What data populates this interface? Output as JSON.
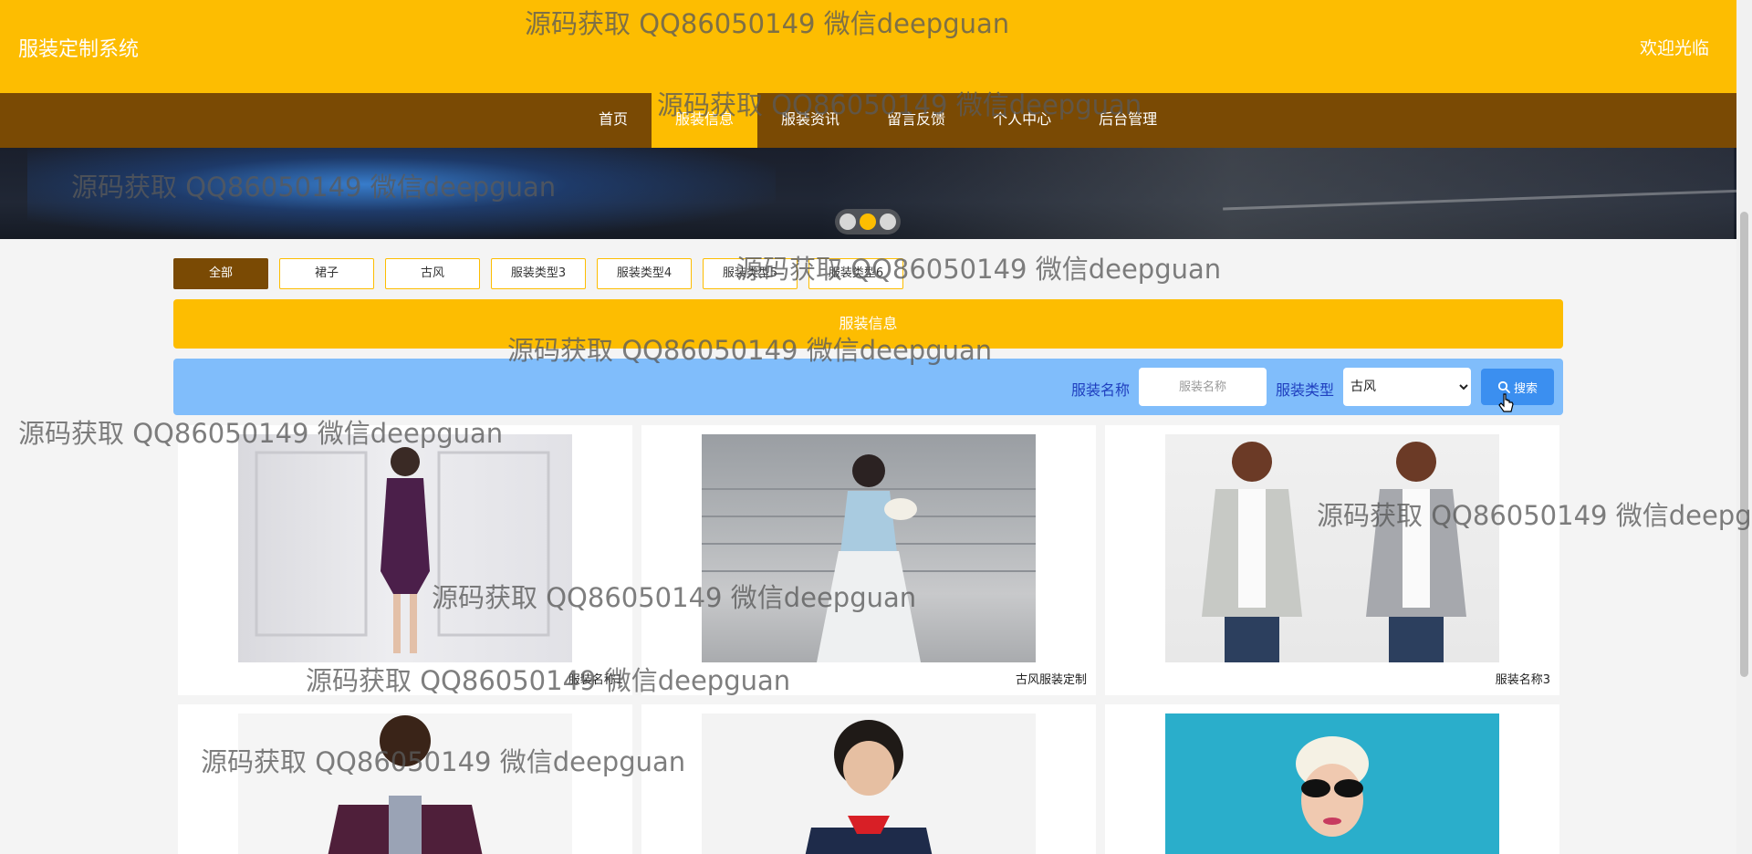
{
  "header": {
    "site_title": "服装定制系统",
    "welcome": "欢迎光临"
  },
  "nav": [
    {
      "label": "首页",
      "active": false
    },
    {
      "label": "服装信息",
      "active": true
    },
    {
      "label": "服装资讯",
      "active": false
    },
    {
      "label": "留言反馈",
      "active": false
    },
    {
      "label": "个人中心",
      "active": false
    },
    {
      "label": "后台管理",
      "active": false
    }
  ],
  "carousel": {
    "slide_count": 3,
    "active_index": 1
  },
  "filters": [
    {
      "label": "全部",
      "active": true
    },
    {
      "label": "裙子",
      "active": false
    },
    {
      "label": "古风",
      "active": false
    },
    {
      "label": "服装类型3",
      "active": false
    },
    {
      "label": "服装类型4",
      "active": false
    },
    {
      "label": "服装类型5",
      "active": false
    },
    {
      "label": "服装类型6",
      "active": false
    }
  ],
  "section": {
    "title": "服装信息"
  },
  "search": {
    "name_label": "服装名称",
    "name_placeholder": "服装名称",
    "type_label": "服装类型",
    "type_selected": "古风",
    "button_label": "搜索"
  },
  "products": [
    {
      "name": "服装名称1"
    },
    {
      "name": "古风服装定制"
    },
    {
      "name": "服装名称3"
    },
    {
      "name": ""
    },
    {
      "name": ""
    },
    {
      "name": ""
    }
  ],
  "watermark": "源码获取 QQ86050149 微信deepguan",
  "colors": {
    "header": "#fdbd01",
    "nav": "#7a4a04",
    "search_bar": "#80bdfb",
    "search_button": "#3b8ff0",
    "label_text": "#1f3fbf"
  }
}
